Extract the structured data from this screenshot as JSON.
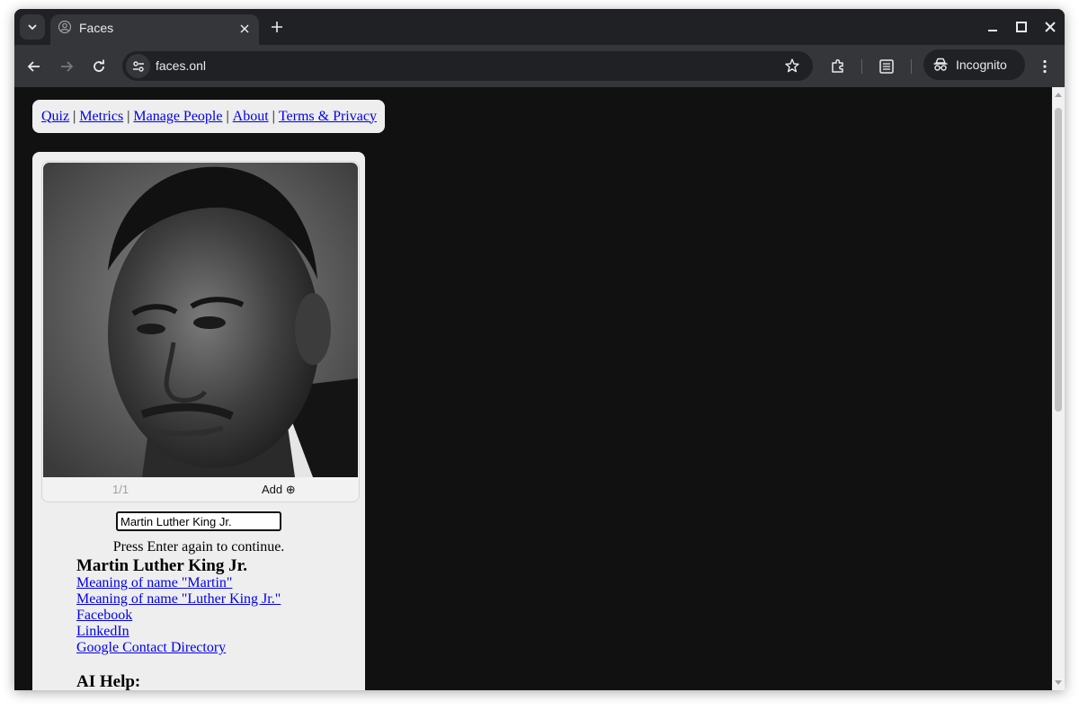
{
  "browser": {
    "tab": {
      "title": "Faces"
    },
    "url": "faces.onl",
    "profile_label": "Incognito"
  },
  "page": {
    "nav": [
      {
        "label": "Quiz"
      },
      {
        "label": "Metrics"
      },
      {
        "label": "Manage People"
      },
      {
        "label": "About"
      },
      {
        "label": "Terms & Privacy"
      }
    ],
    "nav_separator": "|",
    "photo": {
      "counter": "1/1",
      "add_label": "Add ⊕",
      "description": "Black and white portrait photograph"
    },
    "name_input_value": "Martin Luther King Jr.",
    "hint": "Press Enter again to continue.",
    "person_name": "Martin Luther King Jr.",
    "links": [
      {
        "label": "Meaning of name \"Martin\""
      },
      {
        "label": "Meaning of name \"Luther King Jr.\""
      },
      {
        "label": "Facebook"
      },
      {
        "label": "LinkedIn"
      },
      {
        "label": "Google Contact Directory"
      }
    ],
    "ai_help_heading": "AI Help:"
  },
  "colors": {
    "link": "#0000ee",
    "page_background": "#111111",
    "card_background": "#eeeeee"
  }
}
